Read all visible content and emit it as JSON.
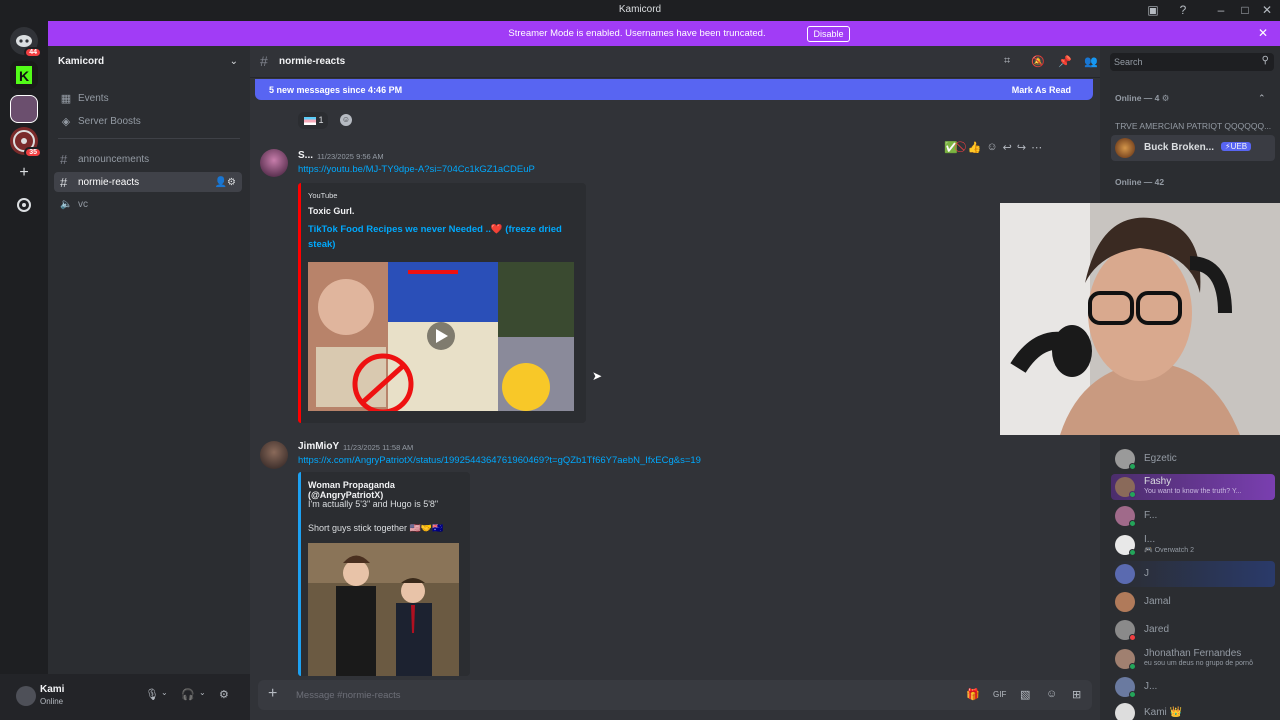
{
  "window": {
    "title": "Kamicord"
  },
  "banner": {
    "text": "Streamer Mode is enabled. Usernames have been truncated.",
    "disable_label": "Disable"
  },
  "guilds": {
    "badges": [
      "44",
      "35"
    ]
  },
  "sidebar": {
    "server_name": "Kamicord",
    "items": [
      {
        "label": "Events",
        "icon": "calendar-icon"
      },
      {
        "label": "Server Boosts",
        "icon": "boost-icon"
      }
    ],
    "channels": [
      {
        "label": "announcements",
        "icon": "hash-icon"
      },
      {
        "label": "normie-reacts",
        "icon": "hash-icon",
        "active": true
      },
      {
        "label": "vc",
        "icon": "speaker-icon"
      }
    ]
  },
  "user": {
    "name": "Kami",
    "status": "Online"
  },
  "channel": {
    "name": "normie-reacts"
  },
  "new_messages": {
    "text": "5 new messages since 4:46 PM",
    "mark_read_label": "Mark As Read"
  },
  "reaction": {
    "count": "1"
  },
  "messages": [
    {
      "author": "S...",
      "timestamp": "11/23/2025 9:56 AM",
      "link": "https://youtu.be/MJ-TY9dpe-A?si=704Cc1kGZ1aCDEuP",
      "embed": {
        "provider": "YouTube",
        "author": "Toxic Gurl.",
        "title": "TikTok Food Recipes we never Needed ..❤️ (freeze dried steak)"
      }
    },
    {
      "author": "JimMioY",
      "timestamp": "11/23/2025 11:58 AM",
      "link": "https://x.com/AngryPatriotX/status/1992544364761960469?t=gQZb1Tf66Y7aebN_IfxECg&s=19",
      "embed": {
        "author": "Woman Propaganda (@AngryPatriotX)",
        "line1": "I'm actually 5'3\" and Hugo is 5'8\"",
        "line2": "Short guys stick together 🇺🇸🤝🇦🇺"
      }
    }
  ],
  "composer": {
    "placeholder": "Message #normie-reacts"
  },
  "search": {
    "placeholder": "Search"
  },
  "members": {
    "group1_label": "Online — 4",
    "role_label": "TRVE AMERCIAN PATRIQT QQQQQQ...",
    "top_member": {
      "name": "Buck Broken...",
      "tag": "UEB"
    },
    "online_label": "Online — 42",
    "list": [
      {
        "name": "Egzetic",
        "sub": ""
      },
      {
        "name": "Fashy",
        "sub": "You want to know the truth? Y..."
      },
      {
        "name": "F...",
        "sub": ""
      },
      {
        "name": "I...",
        "sub": "Overwatch 2"
      },
      {
        "name": "J",
        "sub": ""
      },
      {
        "name": "Jamal",
        "sub": ""
      },
      {
        "name": "Jared",
        "sub": ""
      },
      {
        "name": "Jhonathan Fernandes",
        "sub": "eu sou um deus no grupo de pornô"
      },
      {
        "name": "J...",
        "sub": ""
      },
      {
        "name": "Kami 👑",
        "sub": ""
      }
    ]
  },
  "colors": {
    "accent": "#5865f2",
    "banner": "#a13cf6",
    "link": "#00a8fc",
    "youtube_bar": "#ff0000",
    "twitter_bar": "#1da1f2"
  }
}
